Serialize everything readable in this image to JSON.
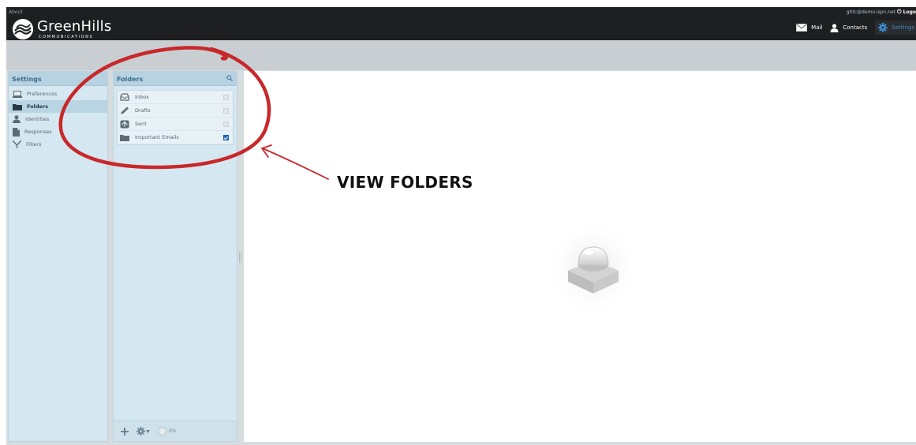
{
  "header": {
    "about_link": "About",
    "user_email": "ghtc@demo.ispn.net",
    "logout_label": "Logo",
    "brand_name": "GreenHills",
    "brand_tagline": "COMMUNICATIONS",
    "nav": [
      {
        "label": "Mail",
        "icon": "mail-icon"
      },
      {
        "label": "Contacts",
        "icon": "contacts-icon"
      },
      {
        "label": "Settings",
        "icon": "gear-icon",
        "active": true
      }
    ]
  },
  "settings_panel": {
    "title": "Settings",
    "items": [
      {
        "label": "Preferences",
        "icon": "monitor-icon"
      },
      {
        "label": "Folders",
        "icon": "folder-icon",
        "selected": true
      },
      {
        "label": "Identities",
        "icon": "person-icon"
      },
      {
        "label": "Responses",
        "icon": "document-icon"
      },
      {
        "label": "Filters",
        "icon": "filter-icon"
      }
    ]
  },
  "folders_panel": {
    "title": "Folders",
    "folders": [
      {
        "label": "Inbox",
        "icon": "inbox-icon",
        "subscribed": true,
        "locked": true
      },
      {
        "label": "Drafts",
        "icon": "pencil-icon",
        "subscribed": true,
        "locked": true
      },
      {
        "label": "Sent",
        "icon": "sent-icon",
        "subscribed": true,
        "locked": true
      },
      {
        "label": "Important Emails",
        "icon": "folder-icon",
        "subscribed": true,
        "locked": false
      }
    ],
    "quota_label": "0%"
  },
  "annotation": {
    "label": "VIEW FOLDERS"
  },
  "colors": {
    "topbar": "#1e1f20",
    "accent": "#3a8fd6",
    "panel_bg": "#d5e7f1",
    "panel_header": "#b7d2e1",
    "annotation_red": "#c8282a"
  }
}
